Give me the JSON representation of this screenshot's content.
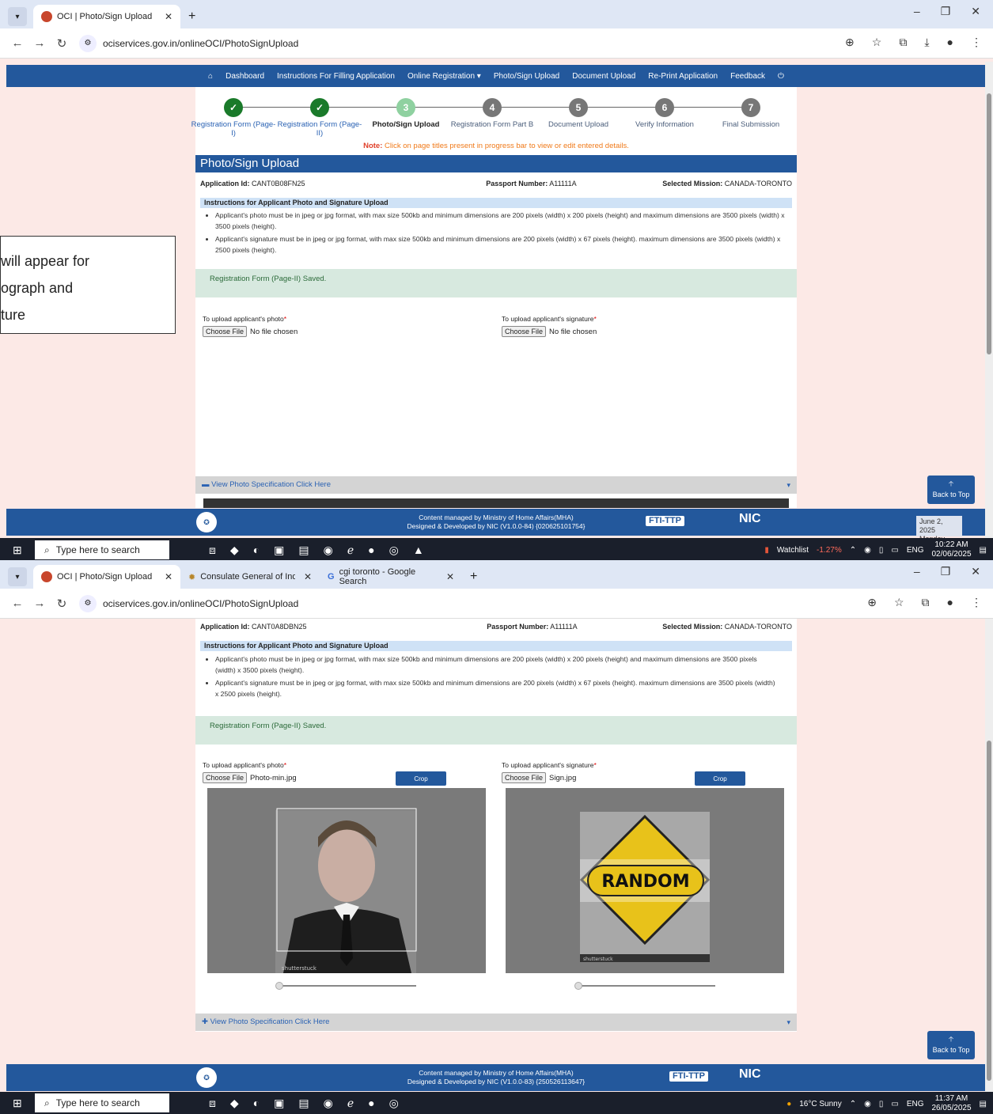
{
  "shot1": {
    "tabs": [
      {
        "title": "OCI | Photo/Sign Upload"
      }
    ],
    "url": "ociservices.gov.in/onlineOCI/PhotoSignUpload",
    "nav": [
      "Dashboard",
      "Instructions For Filling Application",
      "Online Registration ▾",
      "Photo/Sign Upload",
      "Document Upload",
      "Re-Print Application",
      "Feedback"
    ],
    "steps": [
      {
        "num": "✓",
        "label": "Registration Form (Page-I)",
        "state": "done"
      },
      {
        "num": "✓",
        "label": "Registration Form (Page-II)",
        "state": "done"
      },
      {
        "num": "3",
        "label": "Photo/Sign Upload",
        "state": "cur"
      },
      {
        "num": "4",
        "label": "Registration Form Part B",
        "state": "todo"
      },
      {
        "num": "5",
        "label": "Document Upload",
        "state": "todo"
      },
      {
        "num": "6",
        "label": "Verify Information",
        "state": "todo"
      },
      {
        "num": "7",
        "label": "Final Submission",
        "state": "todo"
      }
    ],
    "note_label": "Note:",
    "note_text": "Click on page titles present in progress bar to view or edit entered details.",
    "title": "Photo/Sign Upload",
    "app_id_label": "Application Id:",
    "app_id": "CANT0B08FN25",
    "passport_label": "Passport Number:",
    "passport": "A11111A",
    "mission_label": "Selected Mission:",
    "mission": "CANADA-TORONTO",
    "instr_heading": "Instructions for Applicant Photo and Signature Upload",
    "instr1": "Applicant's photo must be in jpeg or jpg format, with max size 500kb and minimum dimensions are 200 pixels (width) x 200 pixels (height) and maximum dimensions are 3500 pixels (width) x 3500 pixels (height).",
    "instr2": "Applicant's signature must be in jpeg or jpg format, with max size 500kb and minimum dimensions are 200 pixels (width) x 67 pixels (height). maximum dimensions are 3500 pixels (width) x 2500 pixels (height).",
    "saved": "Registration Form (Page-II) Saved.",
    "photo_label": "To upload applicant's photo",
    "sign_label": "To upload applicant's signature",
    "choose": "Choose File",
    "no_file": "No file chosen",
    "spec": "View Photo Specification Click Here",
    "back_to_top": "Back to Top",
    "footer1": "Content managed by Ministry of Home Affairs(MHA)",
    "footer2": "Designed & Developed by NIC (V1.0.0-84) {020625101754}",
    "ftlogo": "FTI-TTP",
    "niclogo": "NIC",
    "search": "Type here to search",
    "watchlist": "Watchlist",
    "watch_change": "-1.27%",
    "lang": "ENG",
    "time": "10:22 AM",
    "date": "02/06/2025",
    "tooltip_date": "June 2, 2025",
    "tooltip_day": "Monday",
    "callout_line1": "will appear for",
    "callout_line2": "ograph and",
    "callout_line3": "ture"
  },
  "shot2": {
    "tabs": [
      {
        "title": "OCI | Photo/Sign Upload"
      },
      {
        "title": "Consulate General of India, Toro"
      },
      {
        "title": "cgi toronto - Google Search"
      }
    ],
    "url": "ociservices.gov.in/onlineOCI/PhotoSignUpload",
    "app_id_label": "Application Id:",
    "app_id": "CANT0A8DBN25",
    "passport_label": "Passport Number:",
    "passport": "A11111A",
    "mission_label": "Selected Mission:",
    "mission": "CANADA-TORONTO",
    "instr_heading": "Instructions for Applicant Photo and Signature Upload",
    "instr1": "Applicant's photo must be in jpeg or jpg format, with max size 500kb and minimum dimensions are 200 pixels (width) x 200 pixels (height) and maximum dimensions are 3500 pixels (width) x 3500 pixels (height).",
    "instr2": "Applicant's signature must be in jpeg or jpg format, with max size 500kb and minimum dimensions are 200 pixels (width) x 67 pixels (height). maximum dimensions are 3500 pixels (width) x 2500 pixels (height).",
    "saved": "Registration Form (Page-II) Saved.",
    "photo_label": "To upload applicant's photo",
    "sign_label": "To upload applicant's signature",
    "choose": "Choose File",
    "photo_file": "Photo-min.jpg",
    "sign_file": "Sign.jpg",
    "crop": "Crop",
    "sign_text": "RANDOM",
    "watermark": "shutterstuck",
    "spec": "View Photo Specification Click Here",
    "back_to_top": "Back to Top",
    "footer1": "Content managed by Ministry of Home Affairs(MHA)",
    "footer2": "Designed & Developed by NIC (V1.0.0-83) {250526113647}",
    "ftlogo": "FTI-TTP",
    "niclogo": "NIC",
    "search": "Type here to search",
    "weather": "16°C  Sunny",
    "lang": "ENG",
    "time": "11:37 AM",
    "date": "26/05/2025"
  },
  "colors": {
    "navy": "#23589c",
    "green": "#1a7a2a",
    "saved": "#d7e9df",
    "note": "#f07a1a"
  }
}
